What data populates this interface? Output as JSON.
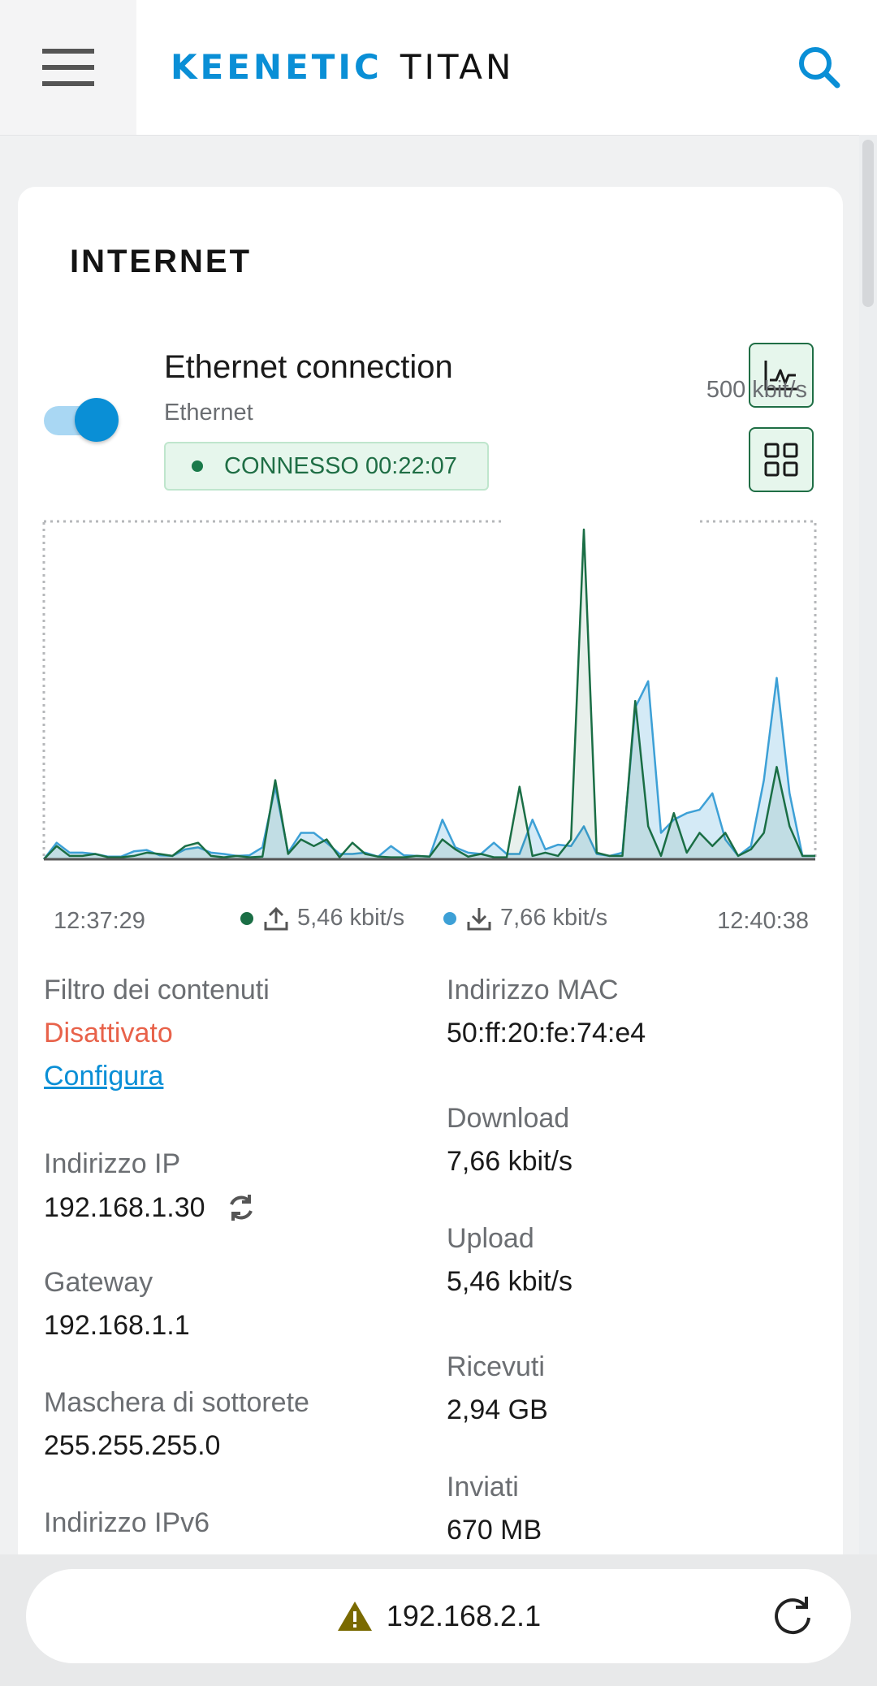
{
  "header": {
    "brand": "KEENETIC",
    "model": "TITAN"
  },
  "card": {
    "title": "INTERNET",
    "connection": {
      "name": "Ethernet connection",
      "type": "Ethernet",
      "status": "CONNESSO 00:22:07",
      "enabled": true
    }
  },
  "chart_data": {
    "type": "area",
    "max_label": "500 kbit/s",
    "ylim": [
      0,
      500
    ],
    "x_start": "12:37:29",
    "x_end": "12:40:38",
    "series": [
      {
        "name": "5,46 kbit/s",
        "color": "#1a6e45",
        "values": [
          0,
          20,
          5,
          5,
          8,
          3,
          3,
          5,
          10,
          8,
          5,
          20,
          25,
          5,
          3,
          5,
          3,
          4,
          120,
          8,
          30,
          20,
          30,
          3,
          25,
          8,
          4,
          3,
          3,
          5,
          4,
          30,
          15,
          4,
          8,
          3,
          3,
          110,
          5,
          10,
          5,
          30,
          500,
          10,
          5,
          5,
          240,
          50,
          5,
          70,
          10,
          40,
          20,
          40,
          5,
          15,
          40,
          140,
          50,
          5,
          5
        ]
      },
      {
        "name": "7,66 kbit/s",
        "color": "#3da0d6",
        "values": [
          0,
          25,
          10,
          10,
          8,
          4,
          4,
          12,
          14,
          6,
          5,
          15,
          18,
          10,
          8,
          5,
          6,
          18,
          110,
          10,
          40,
          40,
          25,
          8,
          8,
          10,
          4,
          20,
          6,
          5,
          4,
          60,
          18,
          10,
          8,
          25,
          8,
          8,
          60,
          15,
          22,
          20,
          50,
          8,
          5,
          10,
          230,
          270,
          40,
          60,
          70,
          75,
          100,
          30,
          5,
          20,
          120,
          275,
          100,
          5,
          5
        ]
      }
    ],
    "legend": {
      "upload": "5,46 kbit/s",
      "download": "7,66 kbit/s"
    }
  },
  "details": {
    "content_filter": {
      "label": "Filtro dei contenuti",
      "value": "Disattivato",
      "action": "Configura"
    },
    "ip": {
      "label": "Indirizzo IP",
      "value": "192.168.1.30"
    },
    "gateway": {
      "label": "Gateway",
      "value": "192.168.1.1"
    },
    "subnet": {
      "label": "Maschera di sottorete",
      "value": "255.255.255.0"
    },
    "ipv6": {
      "label": "Indirizzo IPv6"
    },
    "mac": {
      "label": "Indirizzo MAC",
      "value": "50:ff:20:fe:74:e4"
    },
    "download": {
      "label": "Download",
      "value": "7,66 kbit/s"
    },
    "upload": {
      "label": "Upload",
      "value": "5,46 kbit/s"
    },
    "received": {
      "label": "Ricevuti",
      "value": "2,94 GB"
    },
    "sent": {
      "label": "Inviati",
      "value": "670 MB"
    }
  },
  "browser": {
    "url": "192.168.2.1"
  },
  "colors": {
    "accent": "#0a8fd6",
    "connected_green": "#1f6e45",
    "warning": "#e8624a"
  }
}
